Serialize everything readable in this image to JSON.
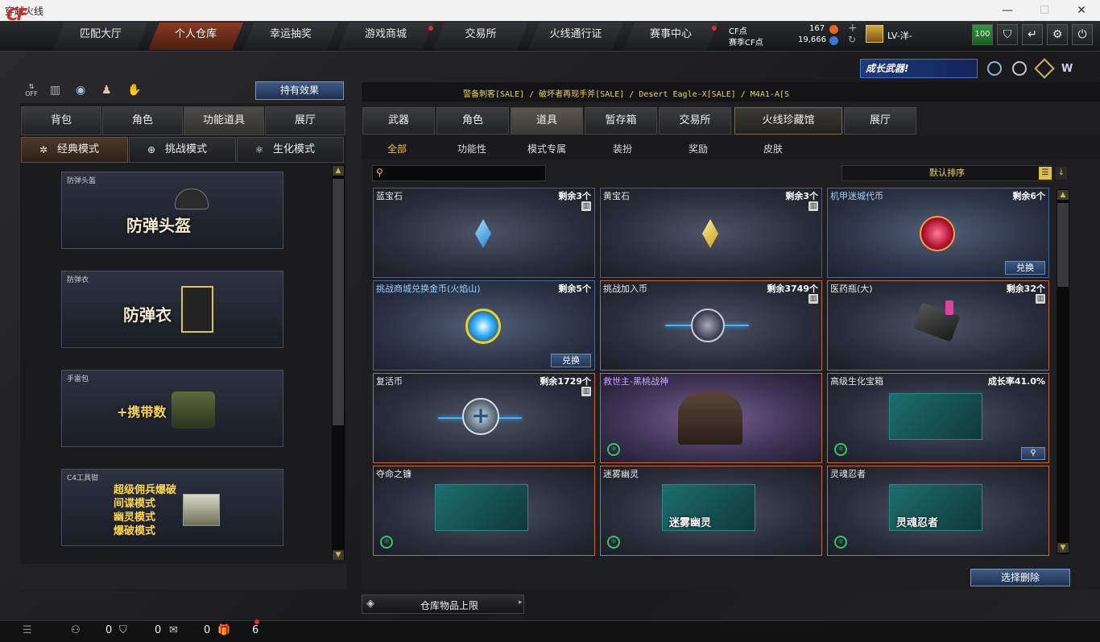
{
  "window": {
    "title": "穿越火线",
    "min": "—",
    "max": "☐",
    "close": "✕"
  },
  "nav": {
    "logo": "CF",
    "tabs": [
      {
        "label": "匹配大厅"
      },
      {
        "label": "个人仓库"
      },
      {
        "label": "幸运抽奖"
      },
      {
        "label": "游戏商城"
      },
      {
        "label": "交易所"
      },
      {
        "label": "火线通行证"
      },
      {
        "label": "赛事中心"
      }
    ],
    "cf_label": "CF点",
    "cf_value": "167",
    "event_cf_label": "赛季CF点",
    "event_cf_value": "19,666",
    "level_text": "LV-洋-",
    "badge_value": "100"
  },
  "promo": {
    "banner": "成长武器!"
  },
  "left": {
    "effect_button": "持有效果",
    "tabs": [
      "背包",
      "角色",
      "功能道具",
      "展厅"
    ],
    "modes": [
      "经典模式",
      "挑战模式",
      "生化模式"
    ],
    "cards": [
      {
        "label": "防弹头盔",
        "title": "防弹头盔"
      },
      {
        "label": "防弹衣",
        "title": "防弹衣"
      },
      {
        "label": "手雷包",
        "title": "+携带数"
      },
      {
        "label": "C4工具钳",
        "lines": [
          "超级佣兵爆破",
          "间谍模式",
          "幽灵模式",
          "爆破模式"
        ]
      }
    ]
  },
  "right": {
    "scroller": "警备刺客[SALE] / 破坏者再现手斧[SALE] / Desert Eagle-X[SALE] / M4A1-A[S",
    "tabs": [
      "武器",
      "角色",
      "道具",
      "暂存箱",
      "交易所",
      "火线珍藏馆",
      "展厅"
    ],
    "subtabs": [
      "全部",
      "功能性",
      "模式专属",
      "装扮",
      "奖励",
      "皮肤"
    ],
    "sort_label": "默认排序",
    "items": [
      {
        "name": "蓝宝石",
        "count": "剩余3个"
      },
      {
        "name": "黄宝石",
        "count": "剩余3个"
      },
      {
        "name": "机甲迷城代币",
        "count": "剩余6个",
        "button": "兑换"
      },
      {
        "name": "挑战商城兑换金币(火焰山)",
        "count": "剩余5个",
        "button": "兑换"
      },
      {
        "name": "挑战加入币",
        "count": "剩余3749个"
      },
      {
        "name": "医药瓶(大)",
        "count": "剩余32个"
      },
      {
        "name": "复活币",
        "count": "剩余1729个"
      },
      {
        "name": "救世主-黑桃战神",
        "count": ""
      },
      {
        "name": "高级生化宝箱",
        "count": "成长率41.0%"
      },
      {
        "name": "夺命之镰",
        "count": ""
      },
      {
        "name": "迷雾幽灵",
        "count": "",
        "pic_text": "迷雾幽灵"
      },
      {
        "name": "灵魂忍者",
        "count": "",
        "pic_text": "灵魂忍者"
      }
    ],
    "delete_button": "选择删除",
    "capacity_label": "仓库物品上限"
  },
  "bottom": {
    "friends": "0",
    "clan": "0",
    "messages": "0",
    "gifts": "6"
  }
}
